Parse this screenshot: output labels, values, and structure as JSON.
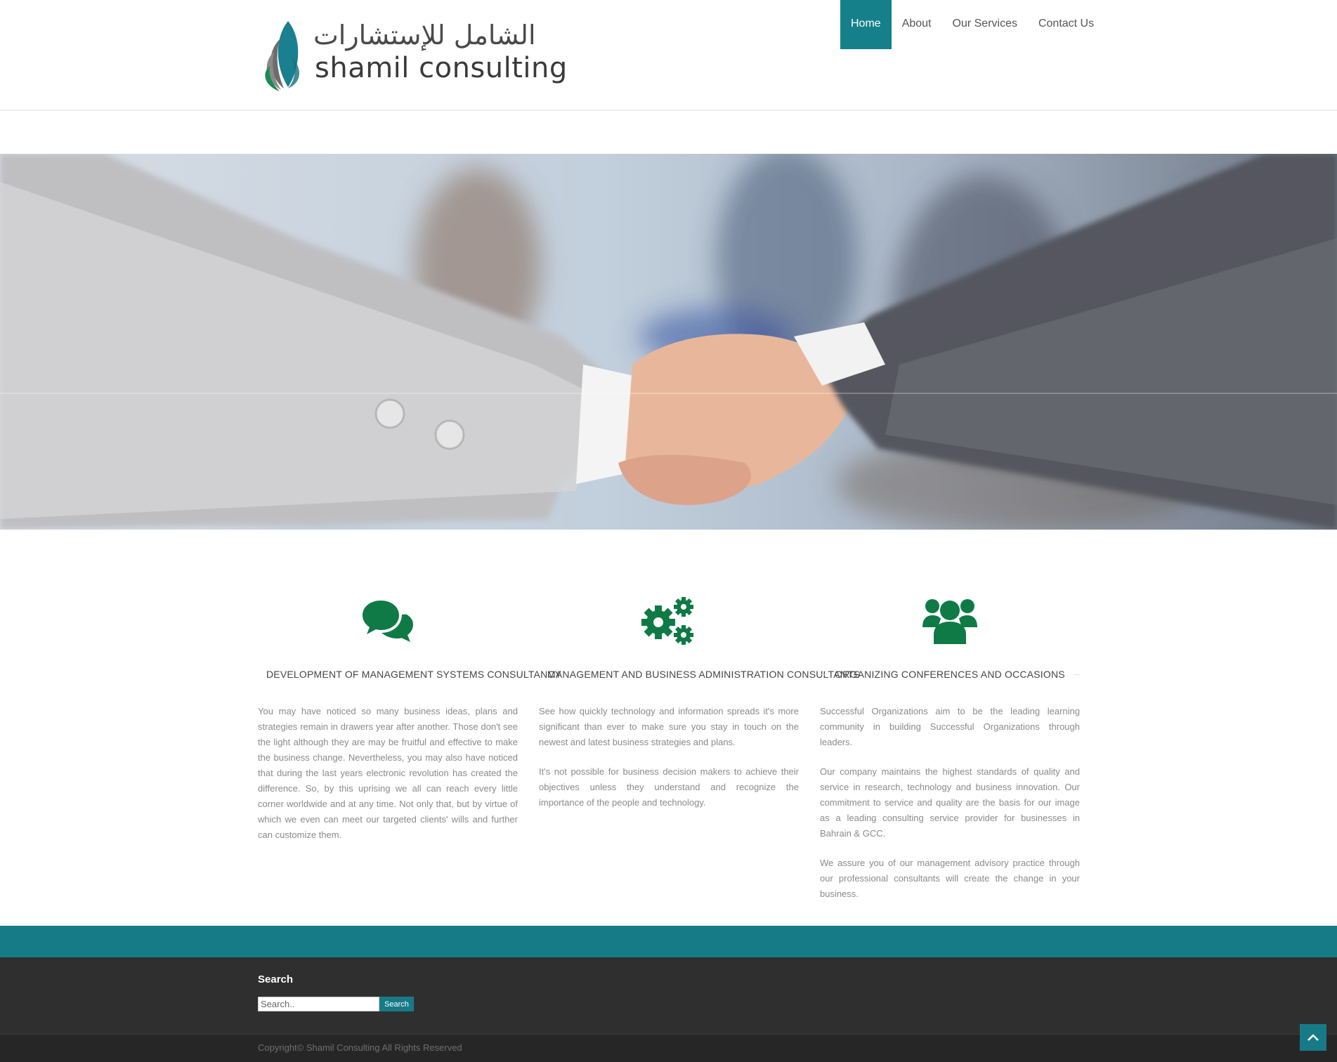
{
  "header": {
    "logo_arabic": "الشامل للإستشارات",
    "logo_latin": "shamil consulting",
    "nav": [
      {
        "label": "Home",
        "active": true
      },
      {
        "label": "About",
        "active": false
      },
      {
        "label": "Our Services",
        "active": false
      },
      {
        "label": "Contact Us",
        "active": false
      }
    ]
  },
  "hero": {
    "image": "business-handshake-photo"
  },
  "features": [
    {
      "icon": "chat-bubbles-icon",
      "title": "DEVELOPMENT OF MANAGEMENT SYSTEMS CONSULTANCY",
      "paragraphs": [
        "You may have noticed so many business ideas, plans and strategies remain in drawers year after another. Those don't see the light although they are may be fruitful and effective to make the business change. Nevertheless, you may also have noticed that during the last years electronic revolution has created the difference. So, by this uprising we all can reach every little corner worldwide and at any time. Not only that, but by virtue of which we even can meet our targeted clients' wills and further can customize them."
      ]
    },
    {
      "icon": "gears-icon",
      "title": "MANAGEMENT AND BUSINESS ADMINISTRATION CONSULTANTS",
      "paragraphs": [
        "See how quickly technology and information spreads it's more significant than ever to make sure you stay in touch on the newest and latest business strategies and plans.",
        "It's not possible for business decision makers to achieve their objectives unless they understand and recognize the importance of the people and technology."
      ]
    },
    {
      "icon": "group-users-icon",
      "title": "ORGANIZING CONFERENCES AND OCCASIONS",
      "paragraphs": [
        "Successful Organizations aim to be the leading learning community in building Successful Organizations through leaders.",
        "Our company maintains the highest standards of quality and service in research, technology and business innovation. Our commitment to service and quality are the basis for our image as a leading consulting service provider for businesses in Bahrain & GCC.",
        "We assure you of our management advisory practice through our professional consultants will create the change in your business."
      ]
    }
  ],
  "footer": {
    "search_title": "Search",
    "search_placeholder": "Search..",
    "search_button": "Search",
    "copyright": "Copyright© Shamil Consulting All Rights Reserved"
  },
  "colors": {
    "accent": "#167b87",
    "icon_green": "#0f7a45",
    "footer_bg": "#2f2f2f"
  }
}
